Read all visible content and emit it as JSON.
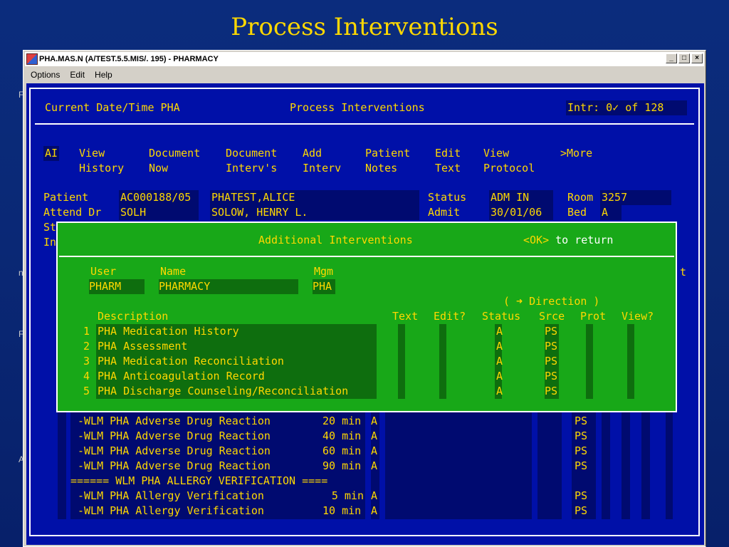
{
  "slide": {
    "title": "Process Interventions"
  },
  "left_edge": [
    "F",
    "n",
    "F",
    "A"
  ],
  "window": {
    "title": "PHA.MAS.N (A/TEST.5.5.MIS/. 195) - PHARMACY",
    "minimize": "_",
    "maximize": "□",
    "close": "×",
    "menu": [
      "Options",
      "Edit",
      "Help"
    ]
  },
  "header": {
    "left": "Current Date/Time PHA",
    "center": "Process Interventions",
    "right": "Intr: 0✓ of 128"
  },
  "actions": [
    {
      "line1": "AI",
      "line2": ""
    },
    {
      "line1": "View",
      "line2": "History"
    },
    {
      "line1": "Document",
      "line2": "Now"
    },
    {
      "line1": "Document",
      "line2": "Interv's"
    },
    {
      "line1": "Add",
      "line2": "Interv"
    },
    {
      "line1": "Patient",
      "line2": "Notes"
    },
    {
      "line1": "Edit",
      "line2": "Text"
    },
    {
      "line1": "View",
      "line2": "Protocol"
    },
    {
      "line1": ">More",
      "line2": ""
    }
  ],
  "patient": {
    "patient_label": "Patient",
    "patient_id": "AC000188/05",
    "patient_name": "PHATEST,ALICE",
    "status_label": "Status",
    "status_value": "ADM IN",
    "room_label": "Room",
    "room_value": "3257",
    "attend_label": "Attend Dr",
    "attend_code": "SOLH",
    "attend_name": "SOLOW, HENRY L.",
    "admit_label": "Admit",
    "admit_value": "30/01/06",
    "bed_label": "Bed",
    "bed_value": "A",
    "st_partial": "St",
    "in_partial": "In",
    "t_partial": "t"
  },
  "dialog": {
    "title": "Additional Interventions",
    "ok": "<OK>",
    "ok_suffix": " to return",
    "user_label": "User",
    "user_value": "PHARM",
    "name_label": "Name",
    "name_value": "PHARMACY",
    "mgm_label": "Mgm",
    "mgm_value": "PHA",
    "direction": "( ➜ Direction )",
    "columns": [
      "Description",
      "Text",
      "Edit?",
      "Status",
      "Srce",
      "Prot",
      "View?"
    ],
    "rows": [
      {
        "num": "1",
        "desc": "PHA Medication History",
        "status": "A",
        "srce": "PS"
      },
      {
        "num": "2",
        "desc": "PHA Assessment",
        "status": "A",
        "srce": "PS"
      },
      {
        "num": "3",
        "desc": "PHA Medication Reconciliation",
        "status": "A",
        "srce": "PS"
      },
      {
        "num": "4",
        "desc": "PHA Anticoagulation Record",
        "status": "A",
        "srce": "PS"
      },
      {
        "num": "5",
        "desc": "PHA Discharge Counseling/Reconciliation",
        "status": "A",
        "srce": "PS"
      }
    ]
  },
  "background_list": [
    {
      "desc": "-WLM PHA Adverse Drug Reaction",
      "time": "20 min",
      "status": "A",
      "srce": "PS"
    },
    {
      "desc": "-WLM PHA Adverse Drug Reaction",
      "time": "40 min",
      "status": "A",
      "srce": "PS"
    },
    {
      "desc": "-WLM PHA Adverse Drug Reaction",
      "time": "60 min",
      "status": "A",
      "srce": "PS"
    },
    {
      "desc": "-WLM PHA Adverse Drug Reaction",
      "time": "90 min",
      "status": "A",
      "srce": "PS"
    },
    {
      "desc": "====== WLM PHA ALLERGY VERIFICATION ====",
      "time": "",
      "status": "",
      "srce": ""
    },
    {
      "desc": "-WLM PHA Allergy Verification",
      "time": "5 min",
      "status": "A",
      "srce": "PS"
    },
    {
      "desc": "-WLM PHA Allergy Verification",
      "time": "10 min",
      "status": "A",
      "srce": "PS"
    }
  ]
}
